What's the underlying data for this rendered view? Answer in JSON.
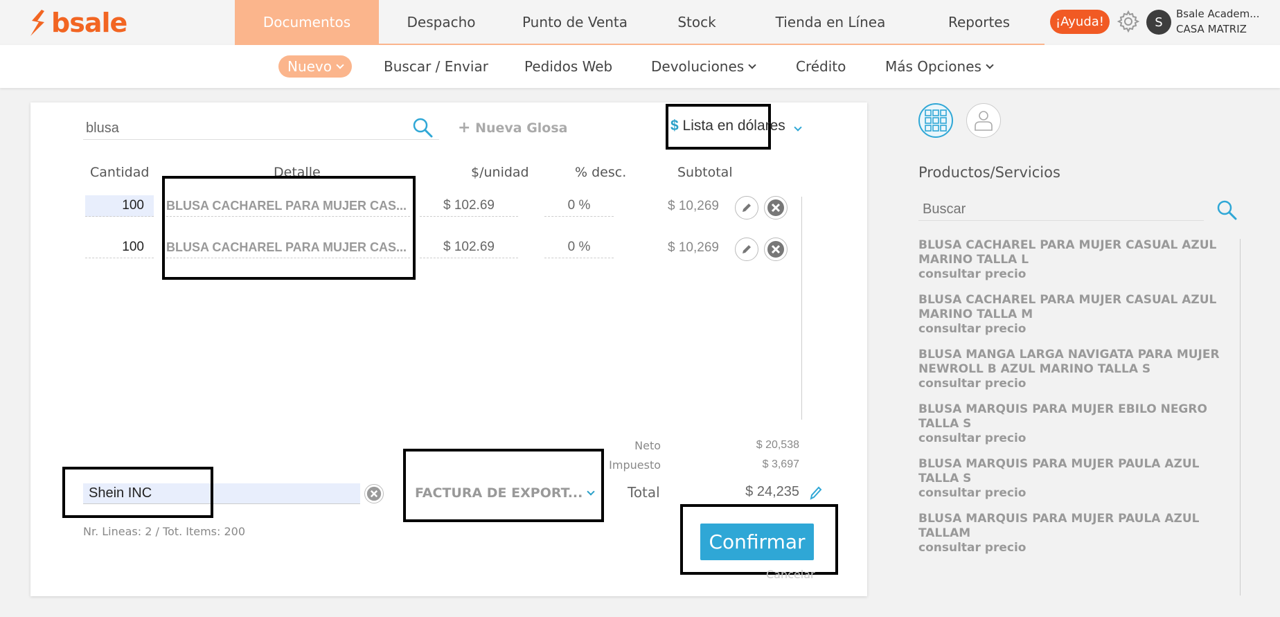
{
  "app": {
    "logo_text": "bsale",
    "brand_color": "#f26522",
    "accent_color": "#fbb58c",
    "link_color": "#2fa7d6"
  },
  "main_nav": [
    {
      "label": "Documentos",
      "active": true
    },
    {
      "label": "Despacho",
      "active": false
    },
    {
      "label": "Punto de Venta",
      "active": false
    },
    {
      "label": "Stock",
      "active": false
    },
    {
      "label": "Tienda en Línea",
      "active": false
    },
    {
      "label": "Reportes",
      "active": false
    }
  ],
  "header": {
    "help_label": "¡Ayuda!",
    "avatar_initial": "S",
    "user_name": "Bsale Academ...",
    "branch": "CASA MATRIZ"
  },
  "sub_nav": {
    "nuevo": "Nuevo",
    "buscar": "Buscar / Enviar",
    "pedidos": "Pedidos Web",
    "devoluciones": "Devoluciones",
    "credito": "Crédito",
    "mas": "Más Opciones"
  },
  "doc": {
    "search_value": "blusa",
    "nueva_glosa": "Nueva Glosa",
    "price_list": {
      "symbol": "$",
      "label": "Lista en dólares"
    },
    "columns": {
      "qty": "Cantidad",
      "detail": "Detalle",
      "unit": "$/unidad",
      "disc": "% desc.",
      "subtotal": "Subtotal"
    },
    "rows": [
      {
        "qty": "100",
        "detail": "BLUSA CACHAREL PARA MUJER CAS...",
        "unit_price": "$ 102.69",
        "discount": "0 %",
        "subtotal": "$ 10,269"
      },
      {
        "qty": "100",
        "detail": "BLUSA CACHAREL PARA MUJER CAS...",
        "unit_price": "$ 102.69",
        "discount": "0 %",
        "subtotal": "$ 10,269"
      }
    ],
    "totals": {
      "neto_label": "Neto",
      "neto": "$ 20,538",
      "impuesto_label": "Impuesto",
      "impuesto": "$ 3,697",
      "total_label": "Total",
      "total": "$ 24,235"
    },
    "client": "Shein INC",
    "doc_type": "FACTURA DE EXPORT...",
    "lines_info": "Nr. Lineas: 2 / Tot. Items: 200",
    "confirm": "Confirmar",
    "cancel": "Cancelar"
  },
  "panel": {
    "title": "Productos/Servicios",
    "search_placeholder": "Buscar",
    "products": [
      {
        "name": "BLUSA CACHAREL PARA MUJER CASUAL AZUL MARINO TALLA L",
        "price": "consultar precio"
      },
      {
        "name": "BLUSA CACHAREL PARA MUJER CASUAL AZUL MARINO TALLA M",
        "price": "consultar precio"
      },
      {
        "name": "BLUSA MANGA LARGA NAVIGATA PARA MUJER NEWROLL B AZUL MARINO TALLA S",
        "price": "consultar precio"
      },
      {
        "name": "BLUSA MARQUIS PARA MUJER EBILO NEGRO TALLA S",
        "price": "consultar precio"
      },
      {
        "name": "BLUSA MARQUIS PARA MUJER PAULA AZUL TALLA S",
        "price": "consultar precio"
      },
      {
        "name": "BLUSA MARQUIS PARA MUJER PAULA AZUL TALLAM",
        "price": "consultar precio"
      }
    ]
  }
}
